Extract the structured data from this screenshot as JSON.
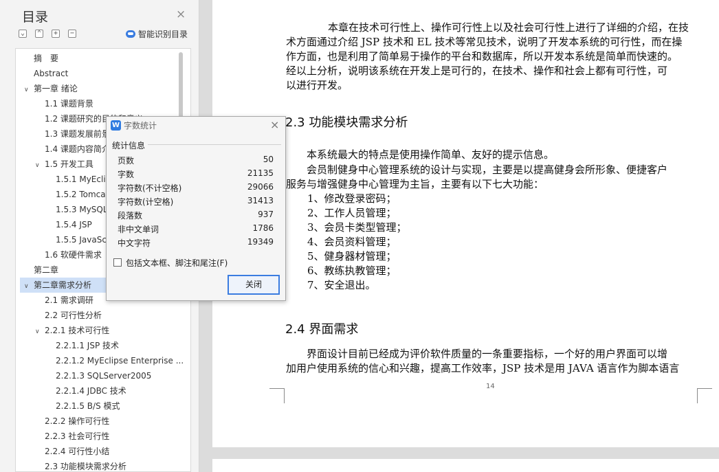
{
  "sidebar": {
    "title": "目录",
    "close_icon": "×",
    "toolbar": {
      "collapse_glyph": "⌄",
      "expand_glyph": "⌃",
      "add_glyph": "+",
      "remove_glyph": "−",
      "smart_label": "智能识别目录"
    },
    "toc": [
      {
        "label": "摘　要"
      },
      {
        "label": "Abstract"
      },
      {
        "chevron": "∨",
        "label": "第一章  绪论"
      },
      {
        "label": "1.1  课题背景"
      },
      {
        "label": "1.2  课题研究的目的和意义"
      },
      {
        "label": "1.3  课题发展前景"
      },
      {
        "label": "1.4  课题内容简介"
      },
      {
        "chevron": "∨",
        "label": "1.5  开发工具"
      },
      {
        "label": "1.5.1  MyEclipse"
      },
      {
        "label": "1.5.2  Tomcat"
      },
      {
        "label": "1.5.3  MySQL"
      },
      {
        "label": "1.5.4  JSP"
      },
      {
        "label": "1.5.5  JavaScript"
      },
      {
        "label": "1.6  软硬件需求"
      },
      {
        "label": "第二章"
      },
      {
        "chevron": "∨",
        "label": "第二章需求分析"
      },
      {
        "label": "2.1  需求调研"
      },
      {
        "label": "2.2  可行性分析"
      },
      {
        "chevron": "∨",
        "label": "2.2.1 技术可行性"
      },
      {
        "label": "2.2.1.1 JSP 技术"
      },
      {
        "label": "2.2.1.2 MyEclipse Enterprise ..."
      },
      {
        "label": "2.2.1.3 SQLServer2005"
      },
      {
        "label": "2.2.1.4 JDBC 技术"
      },
      {
        "label": "2.2.1.5 B/S 模式"
      },
      {
        "label": "2.2.2  操作可行性"
      },
      {
        "label": "2.2.3  社会可行性"
      },
      {
        "label": "2.2.4  可行性小结"
      },
      {
        "label": "2.3  功能模块需求分析"
      }
    ]
  },
  "document": {
    "intro_paragraph": [
      "　　本章在技术可行性上、操作可行性上以及社会可行性上进行了详细的介绍，在技",
      "术方面通过介绍 JSP 技术和 EL 技术等常见技术，说明了开发本系统的可行性，而在操",
      "作方面，也是利用了简单易于操作的平台和数据库，所以开发本系统是简单而快速的。",
      "经以上分析，说明该系统在开发上是可行的，在技术、操作和社会上都有可行性，可",
      "以进行开发。"
    ],
    "heading_23": "2.3  功能模块需求分析",
    "para_23_line1": "　　本系统最大的特点是使用操作简单、友好的提示信息。",
    "para_23_line2": "　　会员制健身中心管理系统的设计与实现，主要是以提高健身会所形象、便捷客户",
    "para_23_line3": "服务与增强健身中心管理为主旨，主要有以下七大功能：",
    "features": [
      "1、修改登录密码；",
      "2、工作人员管理；",
      "3、会员卡类型管理；",
      "4、会员资料管理；",
      "5、健身器材管理；",
      "6、教练执教管理；",
      "7、安全退出。"
    ],
    "heading_24": "2.4  界面需求",
    "para_24_line1": "　　界面设计目前已经成为评价软件质量的一条重要指标，一个好的用户界面可以增",
    "para_24_line2": "加用户使用系统的信心和兴趣，提高工作效率，JSP 技术是用 JAVA 语言作为脚本语言",
    "page_number": "14"
  },
  "dialog": {
    "icon_letter": "W",
    "title": "字数统计",
    "close_icon": "×",
    "section_label": "统计信息",
    "stats": [
      {
        "label": "页数",
        "value": "50"
      },
      {
        "label": "字数",
        "value": "21135"
      },
      {
        "label": "字符数(不计空格)",
        "value": "29066"
      },
      {
        "label": "字符数(计空格)",
        "value": "31413"
      },
      {
        "label": "段落数",
        "value": "937"
      },
      {
        "label": "非中文单词",
        "value": "1786"
      },
      {
        "label": "中文字符",
        "value": "19349"
      }
    ],
    "checkbox_label": "包括文本框、脚注和尾注(F)",
    "checkbox_checked": false,
    "close_button": "关闭"
  },
  "colors": {
    "accent": "#3a7ce0",
    "selected_row": "#cfe0f7"
  }
}
